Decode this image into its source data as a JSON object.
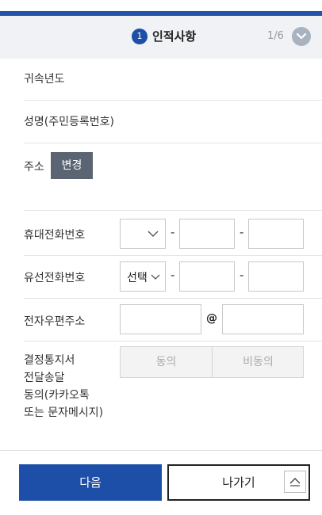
{
  "header": {
    "step_number": "1",
    "step_title": "인적사항",
    "step_count": "1/6"
  },
  "form": {
    "year_label": "귀속년도",
    "name_label": "성명(주민등록번호)",
    "address_label": "주소",
    "address_change_button": "변경",
    "mobile_label": "휴대전화번호",
    "mobile_dash1": "-",
    "mobile_dash2": "-",
    "landline_label": "유선전화번호",
    "landline_select_value": "선택",
    "landline_dash1": "-",
    "landline_dash2": "-",
    "email_label": "전자우편주소",
    "email_at": "@",
    "consent_label_line1": "결정통지서",
    "consent_label_line2": "전달송달",
    "consent_label_line3": "동의(카카오톡",
    "consent_label_line4": "또는 문자메시지)",
    "consent_agree": "동의",
    "consent_disagree": "비동의"
  },
  "footer": {
    "next_button": "다음",
    "exit_button": "나가기"
  },
  "icons": {
    "header_toggle": "chevron-down-icon",
    "scroll_top": "chevron-up-icon"
  },
  "colors": {
    "primary": "#1e4fa8",
    "header_bg": "#f0f2f5",
    "change_button": "#5a6472"
  }
}
